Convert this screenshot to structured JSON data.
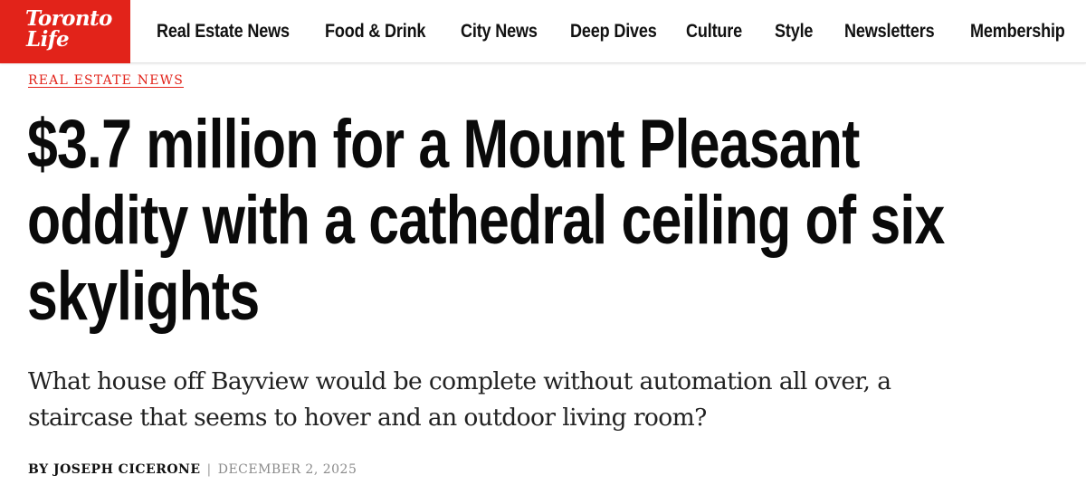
{
  "brand": {
    "logo_line1": "Toronto",
    "logo_line2": "Life",
    "accent_color": "#e2231a"
  },
  "nav": {
    "items": [
      {
        "label": "Real Estate News"
      },
      {
        "label": "Food & Drink"
      },
      {
        "label": "City News"
      },
      {
        "label": "Deep Dives"
      },
      {
        "label": "Culture"
      },
      {
        "label": "Style"
      },
      {
        "label": "Newsletters"
      },
      {
        "label": "Membership"
      }
    ]
  },
  "article": {
    "kicker": "REAL ESTATE NEWS",
    "headline_lines": [
      "$3.7 million for a Mount Pleasant",
      "oddity with a cathedral ceiling of six",
      "skylights"
    ],
    "dek_lines": [
      "What house off Bayview would be complete without automation all over, a",
      "staircase that seems to hover and an outdoor living room?"
    ],
    "byline": {
      "author": "BY JOSEPH CICERONE",
      "separator": "|",
      "date": "DECEMBER 2, 2025"
    }
  }
}
